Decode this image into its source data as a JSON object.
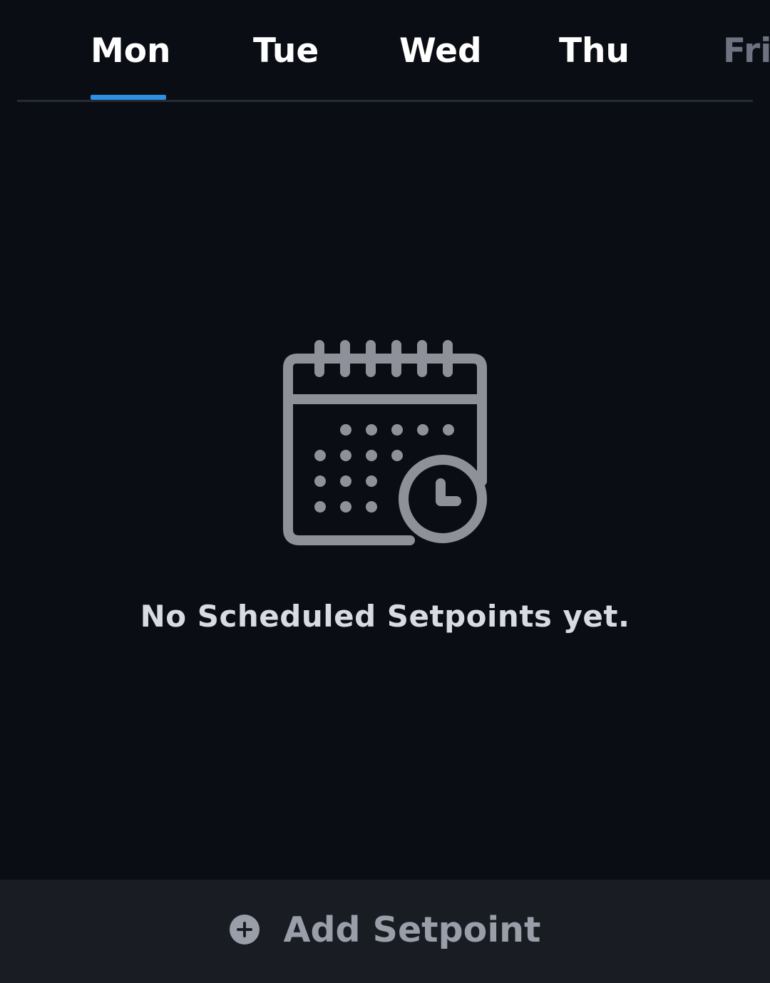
{
  "tabs": [
    {
      "label": "Mon",
      "active": true
    },
    {
      "label": "Tue",
      "active": false
    },
    {
      "label": "Wed",
      "active": false
    },
    {
      "label": "Thu",
      "active": false
    },
    {
      "label": "Fri",
      "active": false
    }
  ],
  "empty_state": {
    "icon": "calendar-clock-icon",
    "message": "No Scheduled Setpoints yet."
  },
  "bottom_action": {
    "icon": "plus-circle-icon",
    "label": "Add Setpoint"
  },
  "colors": {
    "background": "#0a0d14",
    "active_tab_indicator": "#2f8fe0",
    "icon_gray": "#8e919a",
    "bottom_bar": "#191c23"
  }
}
